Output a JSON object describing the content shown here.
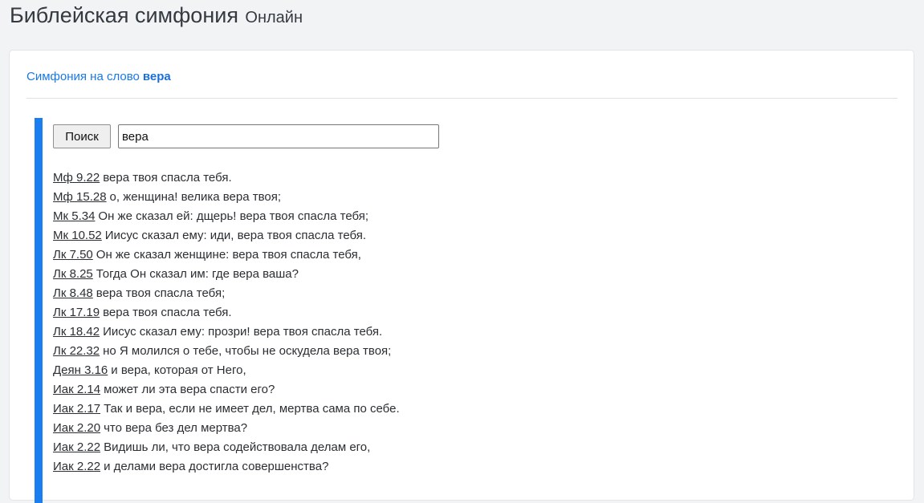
{
  "header": {
    "title": "Библейская симфония",
    "subtitle": "Онлайн"
  },
  "breadcrumb": {
    "prefix": "Симфония на слово",
    "word": "вера"
  },
  "search": {
    "button_label": "Поиск",
    "value": "вера"
  },
  "colors": {
    "accent": "#1a7df0",
    "link": "#1a78e6",
    "background": "#f2f3f5"
  },
  "verses": [
    {
      "ref": "Мф 9.22",
      "text": "вера твоя спасла тебя."
    },
    {
      "ref": "Мф 15.28",
      "text": "о, женщина! велика вера твоя;"
    },
    {
      "ref": "Мк 5.34",
      "text": "Он же сказал ей: дщерь! вера твоя спасла тебя;"
    },
    {
      "ref": "Мк 10.52",
      "text": "Иисус сказал ему: иди, вера твоя спасла тебя."
    },
    {
      "ref": "Лк 7.50",
      "text": "Он же сказал женщине: вера твоя спасла тебя,"
    },
    {
      "ref": "Лк 8.25",
      "text": "Тогда Он сказал им: где вера ваша?"
    },
    {
      "ref": "Лк 8.48",
      "text": "вера твоя спасла тебя;"
    },
    {
      "ref": "Лк 17.19",
      "text": "вера твоя спасла тебя."
    },
    {
      "ref": "Лк 18.42",
      "text": "Иисус сказал ему: прозри! вера твоя спасла тебя."
    },
    {
      "ref": "Лк 22.32",
      "text": "но Я молился о тебе, чтобы не оскудела вера твоя;"
    },
    {
      "ref": "Деян 3.16",
      "text": "и вера, которая от Него,"
    },
    {
      "ref": "Иак 2.14",
      "text": "может ли эта вера спасти его?"
    },
    {
      "ref": "Иак 2.17",
      "text": "Так и вера, если не имеет дел, мертва сама по себе."
    },
    {
      "ref": "Иак 2.20",
      "text": "что вера без дел мертва?"
    },
    {
      "ref": "Иак 2.22",
      "text": "Видишь ли, что вера содействовала делам его,"
    },
    {
      "ref": "Иак 2.22",
      "text": "и делами вера достигла совершенства?"
    }
  ]
}
